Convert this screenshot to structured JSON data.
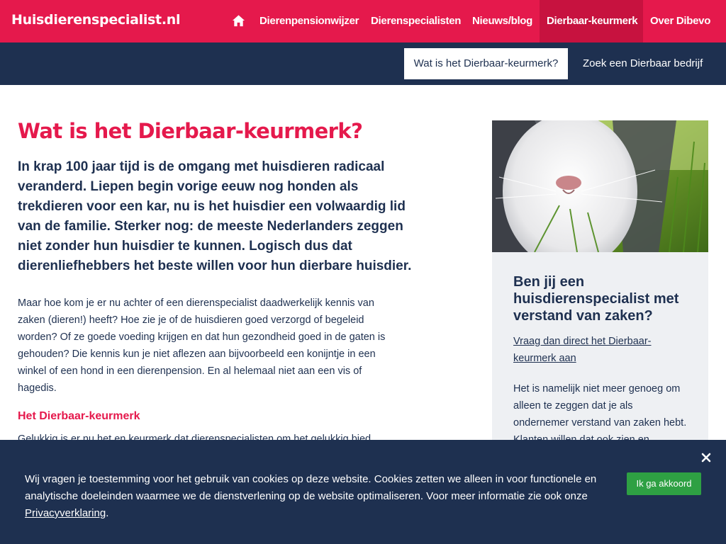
{
  "header": {
    "logo": "Huisdierenspecialist.nl",
    "nav": [
      {
        "label": "Dierenpensionwijzer"
      },
      {
        "label": "Dierenspecialisten"
      },
      {
        "label": "Nieuws/blog"
      },
      {
        "label": "Dierbaar-keurmerk"
      },
      {
        "label": "Over Dibevo"
      }
    ]
  },
  "subnav": {
    "active": "Wat is het Dierbaar-keurmerk?",
    "link": "Zoek een Dierbaar bedrijf"
  },
  "main": {
    "title": "Wat is het Dierbaar-keurmerk?",
    "lead": "In krap 100 jaar tijd is de omgang met huisdieren radicaal veranderd. Liepen begin vorige eeuw nog honden als trekdieren voor een kar, nu is het huisdier een volwaardig lid van de familie. Sterker nog: de meeste Nederlanders zeggen niet zonder hun huisdier te kunnen. Logisch dus dat dierenliefhebbers het beste willen voor hun dierbare huisdier.",
    "body": "Maar hoe kom je er nu achter of een dierenspecialist daadwerkelijk kennis van zaken (dieren!) heeft? Hoe zie je of de huisdieren goed verzorgd of begeleid worden? Of ze goede voeding krijgen en dat hun gezondheid goed in de gaten is gehouden? Die kennis kun je niet aflezen aan bijvoorbeeld een konijntje in een winkel of een hond in een dierenpension. En al helemaal niet aan een vis of hagedis.",
    "subheading": "Het Dierbaar-keurmerk",
    "cut_line": "Gelukkig is er nu het en keurmerk dat dierenspecialisten om het gelukkig bied"
  },
  "card": {
    "title": "Ben jij een huisdierenspecialist met verstand van zaken?",
    "link": "Vraag dan direct het Dierbaar-keurmerk aan",
    "text": "Het is namelijk niet meer genoeg om alleen te zeggen dat je als ondernemer verstand van zaken hebt. Klanten willen dat ook zien en"
  },
  "cookie": {
    "text": "Wij vragen je toestemming voor het gebruik van cookies op deze website. Cookies zetten we alleen in voor functionele en analytische doeleinden waarmee we de dienstverlening op de website optimaliseren. Voor meer informatie zie ook onze ",
    "link": "Privacyverklaring",
    "suffix": ".",
    "accept": "Ik ga akkoord"
  },
  "colors": {
    "brand_red": "#e5194c",
    "navy": "#1e3050",
    "accept_green": "#2ea043"
  },
  "icons": [
    "home-icon",
    "close-icon"
  ]
}
